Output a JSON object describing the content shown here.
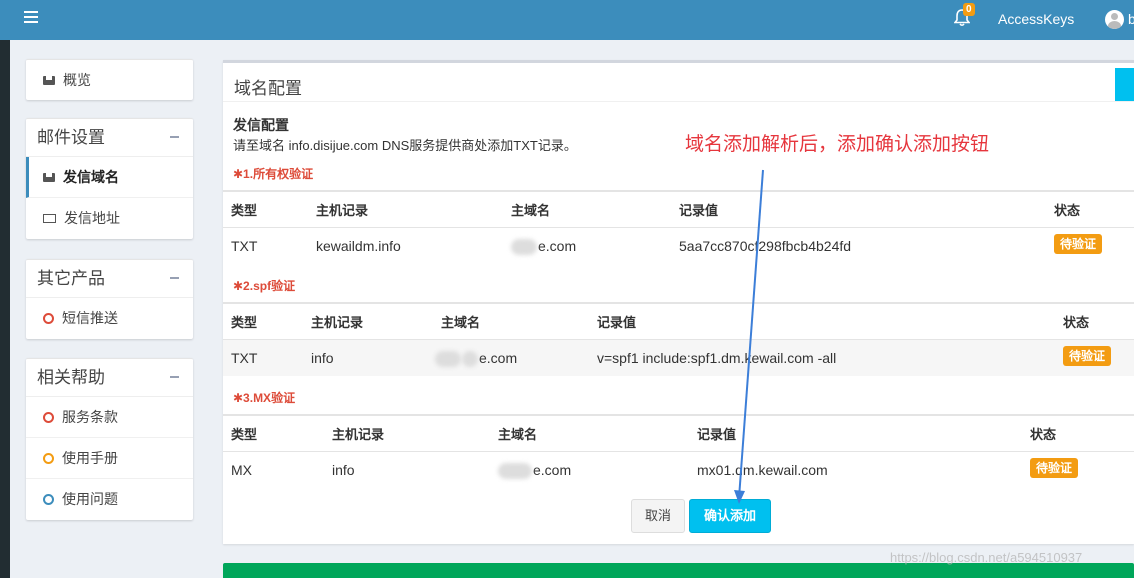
{
  "topbar": {
    "notification_count": "0",
    "access_keys": "AccessKeys",
    "user_initial": "b"
  },
  "sidebar": {
    "overview": {
      "label": "概览",
      "icon": "inbox-icon"
    },
    "mail_settings": {
      "title": "邮件设置",
      "items": [
        {
          "label": "发信域名",
          "icon": "inbox-icon",
          "active": true
        },
        {
          "label": "发信地址",
          "icon": "envelope-icon"
        }
      ]
    },
    "other_products": {
      "title": "其它产品",
      "items": [
        {
          "label": "短信推送",
          "icon": "circle-icon",
          "color": "#dd4b39"
        }
      ]
    },
    "help": {
      "title": "相关帮助",
      "items": [
        {
          "label": "服务条款",
          "icon": "circle-icon",
          "color": "#dd4b39"
        },
        {
          "label": "使用手册",
          "icon": "circle-icon",
          "color": "#f39c12"
        },
        {
          "label": "使用问题",
          "icon": "circle-icon",
          "color": "#3c8dbc"
        }
      ]
    }
  },
  "main": {
    "title": "域名配置",
    "section_title": "发信配置",
    "section_desc": "请至域名 info.disijue.com DNS服务提供商处添加TXT记录。",
    "annotation": "域名添加解析后，添加确认添加按钮",
    "verify1": {
      "label": "✱1.所有权验证",
      "headers": [
        "类型",
        "主机记录",
        "主域名",
        "记录值",
        "状态"
      ],
      "row": {
        "type": "TXT",
        "host": "kewaildm.info",
        "domain_suffix": "e.com",
        "value": "5aa7cc870cf298fbcb4b24fd",
        "status": "待验证"
      }
    },
    "verify2": {
      "label": "✱2.spf验证",
      "headers": [
        "类型",
        "主机记录",
        "主域名",
        "记录值",
        "状态"
      ],
      "row": {
        "type": "TXT",
        "host": "info",
        "domain_suffix": "e.com",
        "value": "v=spf1 include:spf1.dm.kewail.com -all",
        "status": "待验证"
      }
    },
    "verify3": {
      "label": "✱3.MX验证",
      "headers": [
        "类型",
        "主机记录",
        "主域名",
        "记录值",
        "状态"
      ],
      "row": {
        "type": "MX",
        "host": "info",
        "domain_suffix": "e.com",
        "value": "mx01.dm.kewail.com",
        "status": "待验证"
      }
    },
    "cancel": "取消",
    "confirm": "确认添加"
  },
  "watermark": "https://blog.csdn.net/a594510937",
  "colors": {
    "topbar": "#3c8dbc",
    "accent": "#00c0ef",
    "pending": "#f39c12",
    "required": "#dd4b39",
    "annotation": "#e6363d",
    "footer_bar": "#00a65a"
  }
}
